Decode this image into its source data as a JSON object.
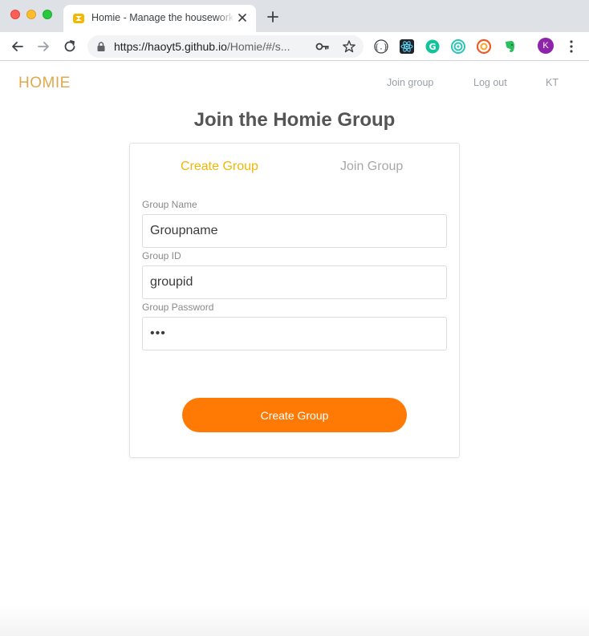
{
  "browser": {
    "tab_title": "Homie - Manage the housework",
    "url_host": "https://haoyt5.github.io",
    "url_path": "/Homie/#/s...",
    "profile_initial": "K",
    "extensions": [
      "code-braces-extension",
      "react-devtools-extension",
      "grammarly-extension",
      "target-extension",
      "clockify-extension",
      "evernote-extension"
    ]
  },
  "header": {
    "brand": "HOMIE",
    "nav": {
      "join_group": "Join group",
      "log_out": "Log out",
      "user": "KT"
    }
  },
  "main": {
    "title": "Join the Homie Group",
    "tabs": {
      "create": "Create Group",
      "join": "Join Group"
    },
    "form": {
      "group_name": {
        "label": "Group Name",
        "value": "Groupname"
      },
      "group_id": {
        "label": "Group ID",
        "value": "groupid"
      },
      "group_password": {
        "label": "Group Password",
        "value": "•••"
      },
      "submit_label": "Create Group"
    }
  },
  "colors": {
    "brand": "#e0a94e",
    "active_tab": "#f2b705",
    "button": "#fe7a05"
  }
}
